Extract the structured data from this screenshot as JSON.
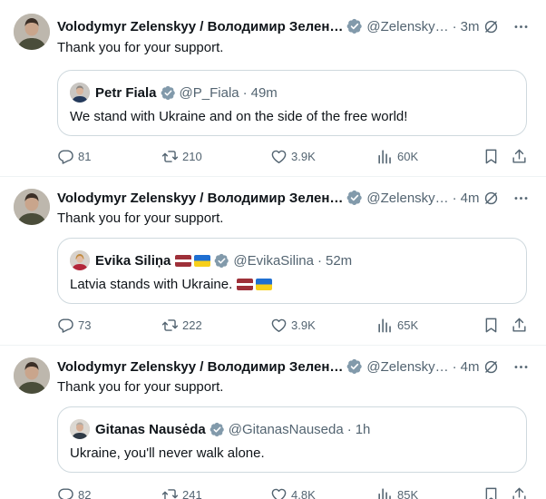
{
  "colors": {
    "text": "#0f1419",
    "secondary": "#536471",
    "verified": "#829aab",
    "border": "#cfd9de"
  },
  "tweets": [
    {
      "author": "Volodymyr Zelenskyy / Володимир Зеленський",
      "author_display": "Volodymyr Zelenskyy / Володимир Зелен…",
      "handle": "@Zelensky…",
      "time": "3m",
      "text": "Thank you for your support.",
      "quote": {
        "author": "Petr Fiala",
        "handle": "@P_Fiala",
        "time": "49m",
        "text": "We stand with Ukraine and on the side of the free world!"
      },
      "stats": {
        "replies": "81",
        "reposts": "210",
        "likes": "3.9K",
        "views": "60K"
      }
    },
    {
      "author": "Volodymyr Zelenskyy / Володимир Зеленський",
      "author_display": "Volodymyr Zelenskyy / Володимир Зелен…",
      "handle": "@Zelensky…",
      "time": "4m",
      "text": "Thank you for your support.",
      "quote": {
        "author": "Evika Siliņa",
        "handle": "@EvikaSilina",
        "time": "52m",
        "text": "Latvia stands with Ukraine.",
        "author_flags": [
          "latvia-flag",
          "ukraine-flag"
        ],
        "text_flags": [
          "latvia-flag",
          "ukraine-flag"
        ]
      },
      "stats": {
        "replies": "73",
        "reposts": "222",
        "likes": "3.9K",
        "views": "65K"
      }
    },
    {
      "author": "Volodymyr Zelenskyy / Володимир Зеленський",
      "author_display": "Volodymyr Zelenskyy / Володимир Зелен…",
      "handle": "@Zelensky…",
      "time": "4m",
      "text": "Thank you for your support.",
      "quote": {
        "author": "Gitanas Nausėda",
        "handle": "@GitanasNauseda",
        "time": "1h",
        "text": "Ukraine, you'll never walk alone."
      },
      "stats": {
        "replies": "82",
        "reposts": "241",
        "likes": "4.8K",
        "views": "85K"
      }
    }
  ],
  "separator": "·",
  "icons": {
    "verified": "verified-badge-icon",
    "grok": "grok-icon",
    "more": "more-icon",
    "reply": "reply-icon",
    "repost": "repost-icon",
    "like": "like-icon",
    "views": "views-icon",
    "bookmark": "bookmark-icon",
    "share": "share-icon"
  }
}
